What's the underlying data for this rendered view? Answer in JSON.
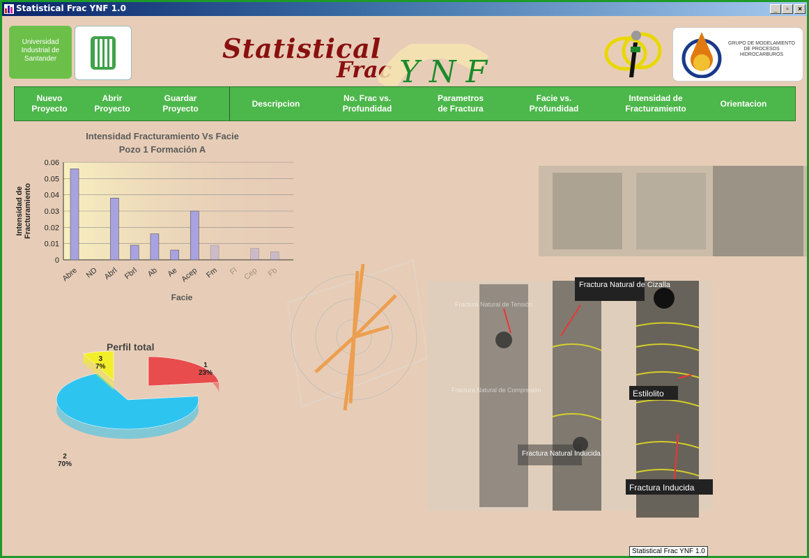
{
  "window": {
    "title": "Statistical Frac YNF 1.0",
    "controls": {
      "minimize": "_",
      "maximize": "▫",
      "close": "×"
    }
  },
  "header": {
    "university": "Universidad Industrial de Santander",
    "app_title_line1": "Statistical",
    "app_title_line2": "Frac",
    "app_title_ynf": "Y N F",
    "group_text": "GRUPO DE MODELAMIENTO DE PROCESOS HIDROCARBUROS"
  },
  "menu": [
    {
      "label": "Nuevo\nProyecto"
    },
    {
      "label": "Abrir\nProyecto"
    },
    {
      "label": "Guardar\nProyecto"
    },
    {
      "label": "Descripcion"
    },
    {
      "label": "No. Frac vs.\nProfundidad"
    },
    {
      "label": "Parametros\nde Fractura"
    },
    {
      "label": "Facie vs.\nProfundidad"
    },
    {
      "label": "Intensidad de\nFracturamiento"
    },
    {
      "label": "Orientacion"
    }
  ],
  "chart_data": [
    {
      "type": "bar",
      "title": "Intensidad Fracturamiento Vs Facie",
      "subtitle": "Pozo 1 Formación A",
      "xlabel": "Facie",
      "ylabel": "Intensidad de Fracturamiento",
      "categories": [
        "Abre",
        "ND",
        "Abrl",
        "Fbrl",
        "Ab",
        "Ae",
        "Acep",
        "Fm",
        "Fl",
        "Cep",
        "Fb"
      ],
      "values": [
        0.056,
        0,
        0.038,
        0.009,
        0.016,
        0.006,
        0.03,
        0.009,
        0,
        0.007,
        0.005
      ],
      "ylim": [
        0,
        0.06
      ],
      "yticks": [
        "0",
        "0.01",
        "0.02",
        "0.03",
        "0.04",
        "0.05",
        "0.06"
      ],
      "bar_color": "#a9a2e0",
      "grid": true
    },
    {
      "type": "pie",
      "title": "Perfil total",
      "slices": [
        {
          "label": "1",
          "percent_label": "23%",
          "value": 23,
          "color": "#e84c4c"
        },
        {
          "label": "2",
          "percent_label": "70%",
          "value": 70,
          "color": "#2ec4f0"
        },
        {
          "label": "3",
          "percent_label": "7%",
          "value": 7,
          "color": "#f2ee2a"
        }
      ]
    }
  ],
  "photos": {
    "labels": {
      "tension": "Fractura Natural de Tensión",
      "compresion": "Fractura Natural de Compresión",
      "inducida_natural": "Fractura Natural Inducida",
      "cizalla": "Fractura Natural de Cizalla",
      "estilolito": "Estilolito",
      "inducida": "Fractura Inducida"
    }
  },
  "tooltip": "Statistical Frac YNF 1.0",
  "colors": {
    "menu_bg": "#4cb74a",
    "title_red": "#8a1010",
    "window_bg": "#e7cdb7"
  }
}
